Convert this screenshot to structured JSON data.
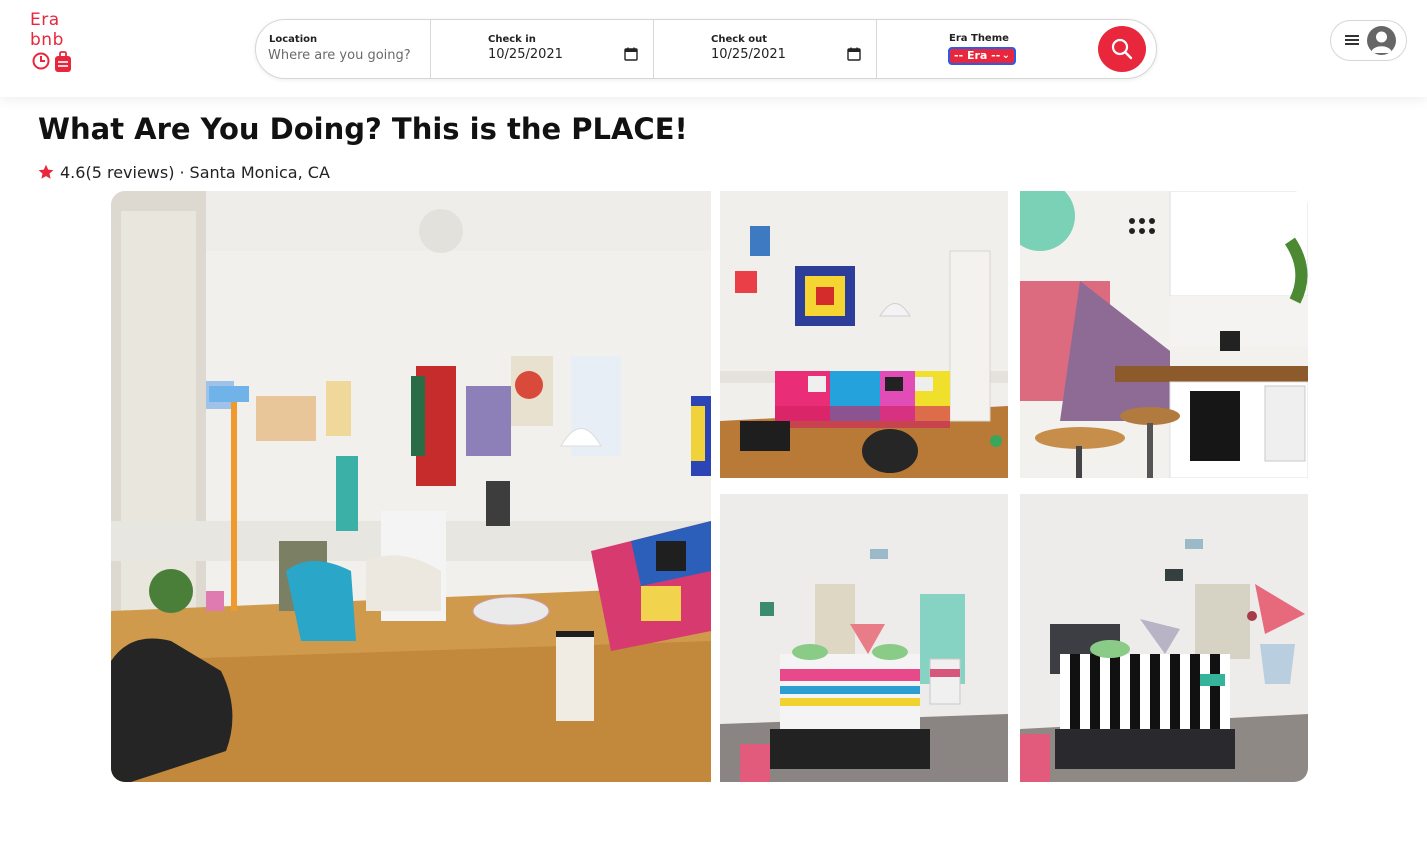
{
  "app": {
    "logo_line1": "Era",
    "logo_line2": "bnb",
    "brand_color": "#e8273d"
  },
  "search": {
    "location_label": "Location",
    "location_placeholder": "Where are you going?",
    "checkin_label": "Check in",
    "checkin_value": "10/25/2021",
    "checkout_label": "Check out",
    "checkout_value": "10/25/2021",
    "era_label": "Era Theme",
    "era_selected": "-- Era --",
    "search_icon": "search-icon"
  },
  "user_menu": {
    "menu_icon": "hamburger-icon",
    "avatar_icon": "user-avatar-icon"
  },
  "listing": {
    "title": "What Are You Doing? This is the PLACE!",
    "rating": "4.6",
    "reviews": "(5 reviews)",
    "separator": "·",
    "location": "Santa Monica, CA",
    "star_icon": "star-icon"
  },
  "gallery": {
    "photos": [
      "living-room-photo",
      "sofa-room-photo",
      "kitchen-photo",
      "bedroom-one-photo",
      "bedroom-two-photo"
    ]
  }
}
